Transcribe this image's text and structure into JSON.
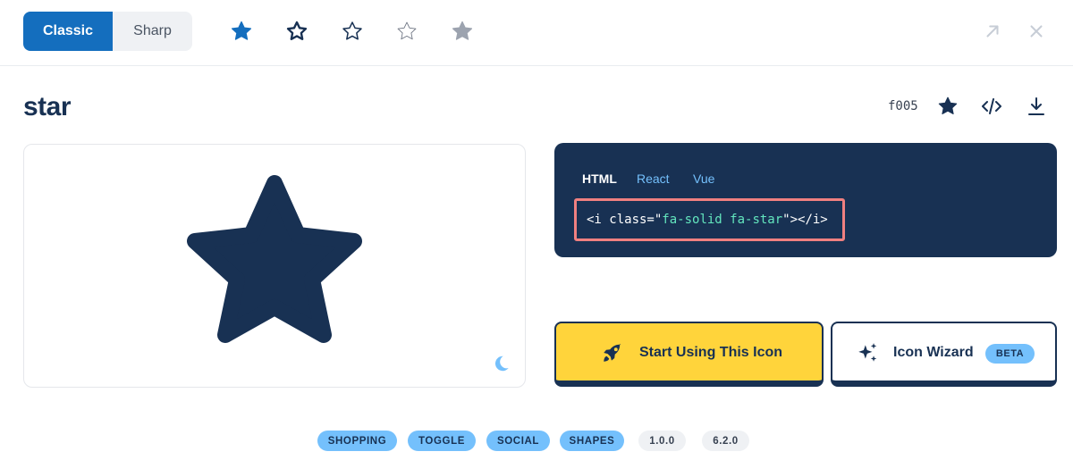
{
  "style_toggle": {
    "classic": "Classic",
    "sharp": "Sharp"
  },
  "style_variants": [
    "solid",
    "regular",
    "light",
    "thin",
    "duotone"
  ],
  "icon": {
    "name": "star",
    "unicode": "f005"
  },
  "code": {
    "tabs": [
      "HTML",
      "React",
      "Vue"
    ],
    "active_tab": "HTML",
    "snippet_open": "<i class=\"",
    "snippet_class": "fa-solid fa-star",
    "snippet_close": "\"></i>"
  },
  "actions": {
    "start_label": "Start Using This Icon",
    "wizard_label": "Icon Wizard",
    "wizard_badge": "BETA"
  },
  "tags": {
    "categories": [
      "SHOPPING",
      "TOGGLE",
      "SOCIAL",
      "SHAPES"
    ],
    "versions": [
      "1.0.0",
      "6.2.0"
    ]
  },
  "colors": {
    "navy": "#183153",
    "blue": "#146ebe",
    "light_blue": "#74c0fc",
    "yellow": "#ffd43b",
    "code_highlight": "#63e6be",
    "outline_highlight": "#f08080"
  }
}
